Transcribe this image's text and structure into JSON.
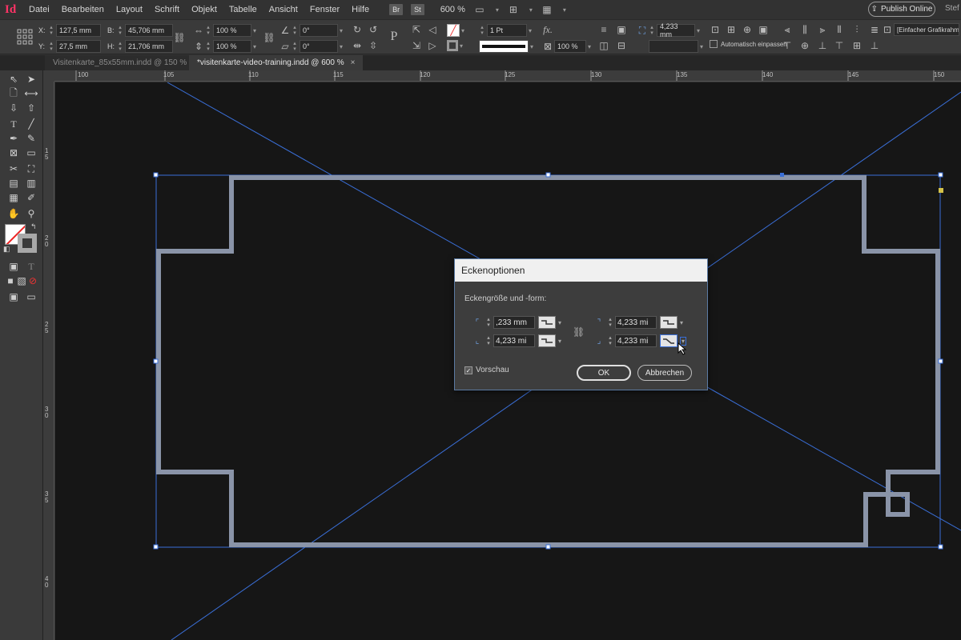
{
  "app": {
    "logo": "Id"
  },
  "menu": [
    "Datei",
    "Bearbeiten",
    "Layout",
    "Schrift",
    "Objekt",
    "Tabelle",
    "Ansicht",
    "Fenster",
    "Hilfe"
  ],
  "menubar": {
    "chip_br": "Br",
    "chip_st": "St",
    "zoom": "600 %",
    "publish": "Publish Online",
    "user": "Stef"
  },
  "control": {
    "x_label": "X:",
    "x_value": "127,5 mm",
    "y_label": "Y:",
    "y_value": "27,5 mm",
    "w_label": "B:",
    "w_value": "45,706 mm",
    "h_label": "H:",
    "h_value": "21,706 mm",
    "scale_x": "100 %",
    "scale_y": "100 %",
    "rotate": "0°",
    "shear": "0°",
    "stroke_weight": "1 Pt",
    "corner_size": "4,233 mm",
    "opacity": "100 %",
    "autofit": "Automatisch einpassen",
    "style": "[Einfacher Grafikrahmen]"
  },
  "tabs": [
    {
      "label": "Visitenkarte_85x55mm.indd @ 150 %",
      "close": "×"
    },
    {
      "label": "*visitenkarte-video-training.indd @ 600 %",
      "close": "×"
    }
  ],
  "ruler_h": [
    "100",
    "105",
    "110",
    "115",
    "120",
    "125",
    "130",
    "135",
    "140",
    "145",
    "150"
  ],
  "ruler_v": [
    "1 5",
    "2 0",
    "2 5",
    "3 0",
    "3 5",
    "4 0"
  ],
  "dialog": {
    "title": "Eckenoptionen",
    "heading": "Eckengröße und -form:",
    "top_left": ",233 mm",
    "top_right": "4,233 mi",
    "bottom_left": "4,233 mi",
    "bottom_right": "4,233 mi",
    "preview_label": "Vorschau",
    "preview_checked": true,
    "ok": "OK",
    "cancel": "Abbrechen"
  },
  "colors": {
    "frame": "#8a94a8",
    "guide": "#3a6fd8",
    "canvas": "#161616",
    "panel": "#3a3a3a"
  }
}
